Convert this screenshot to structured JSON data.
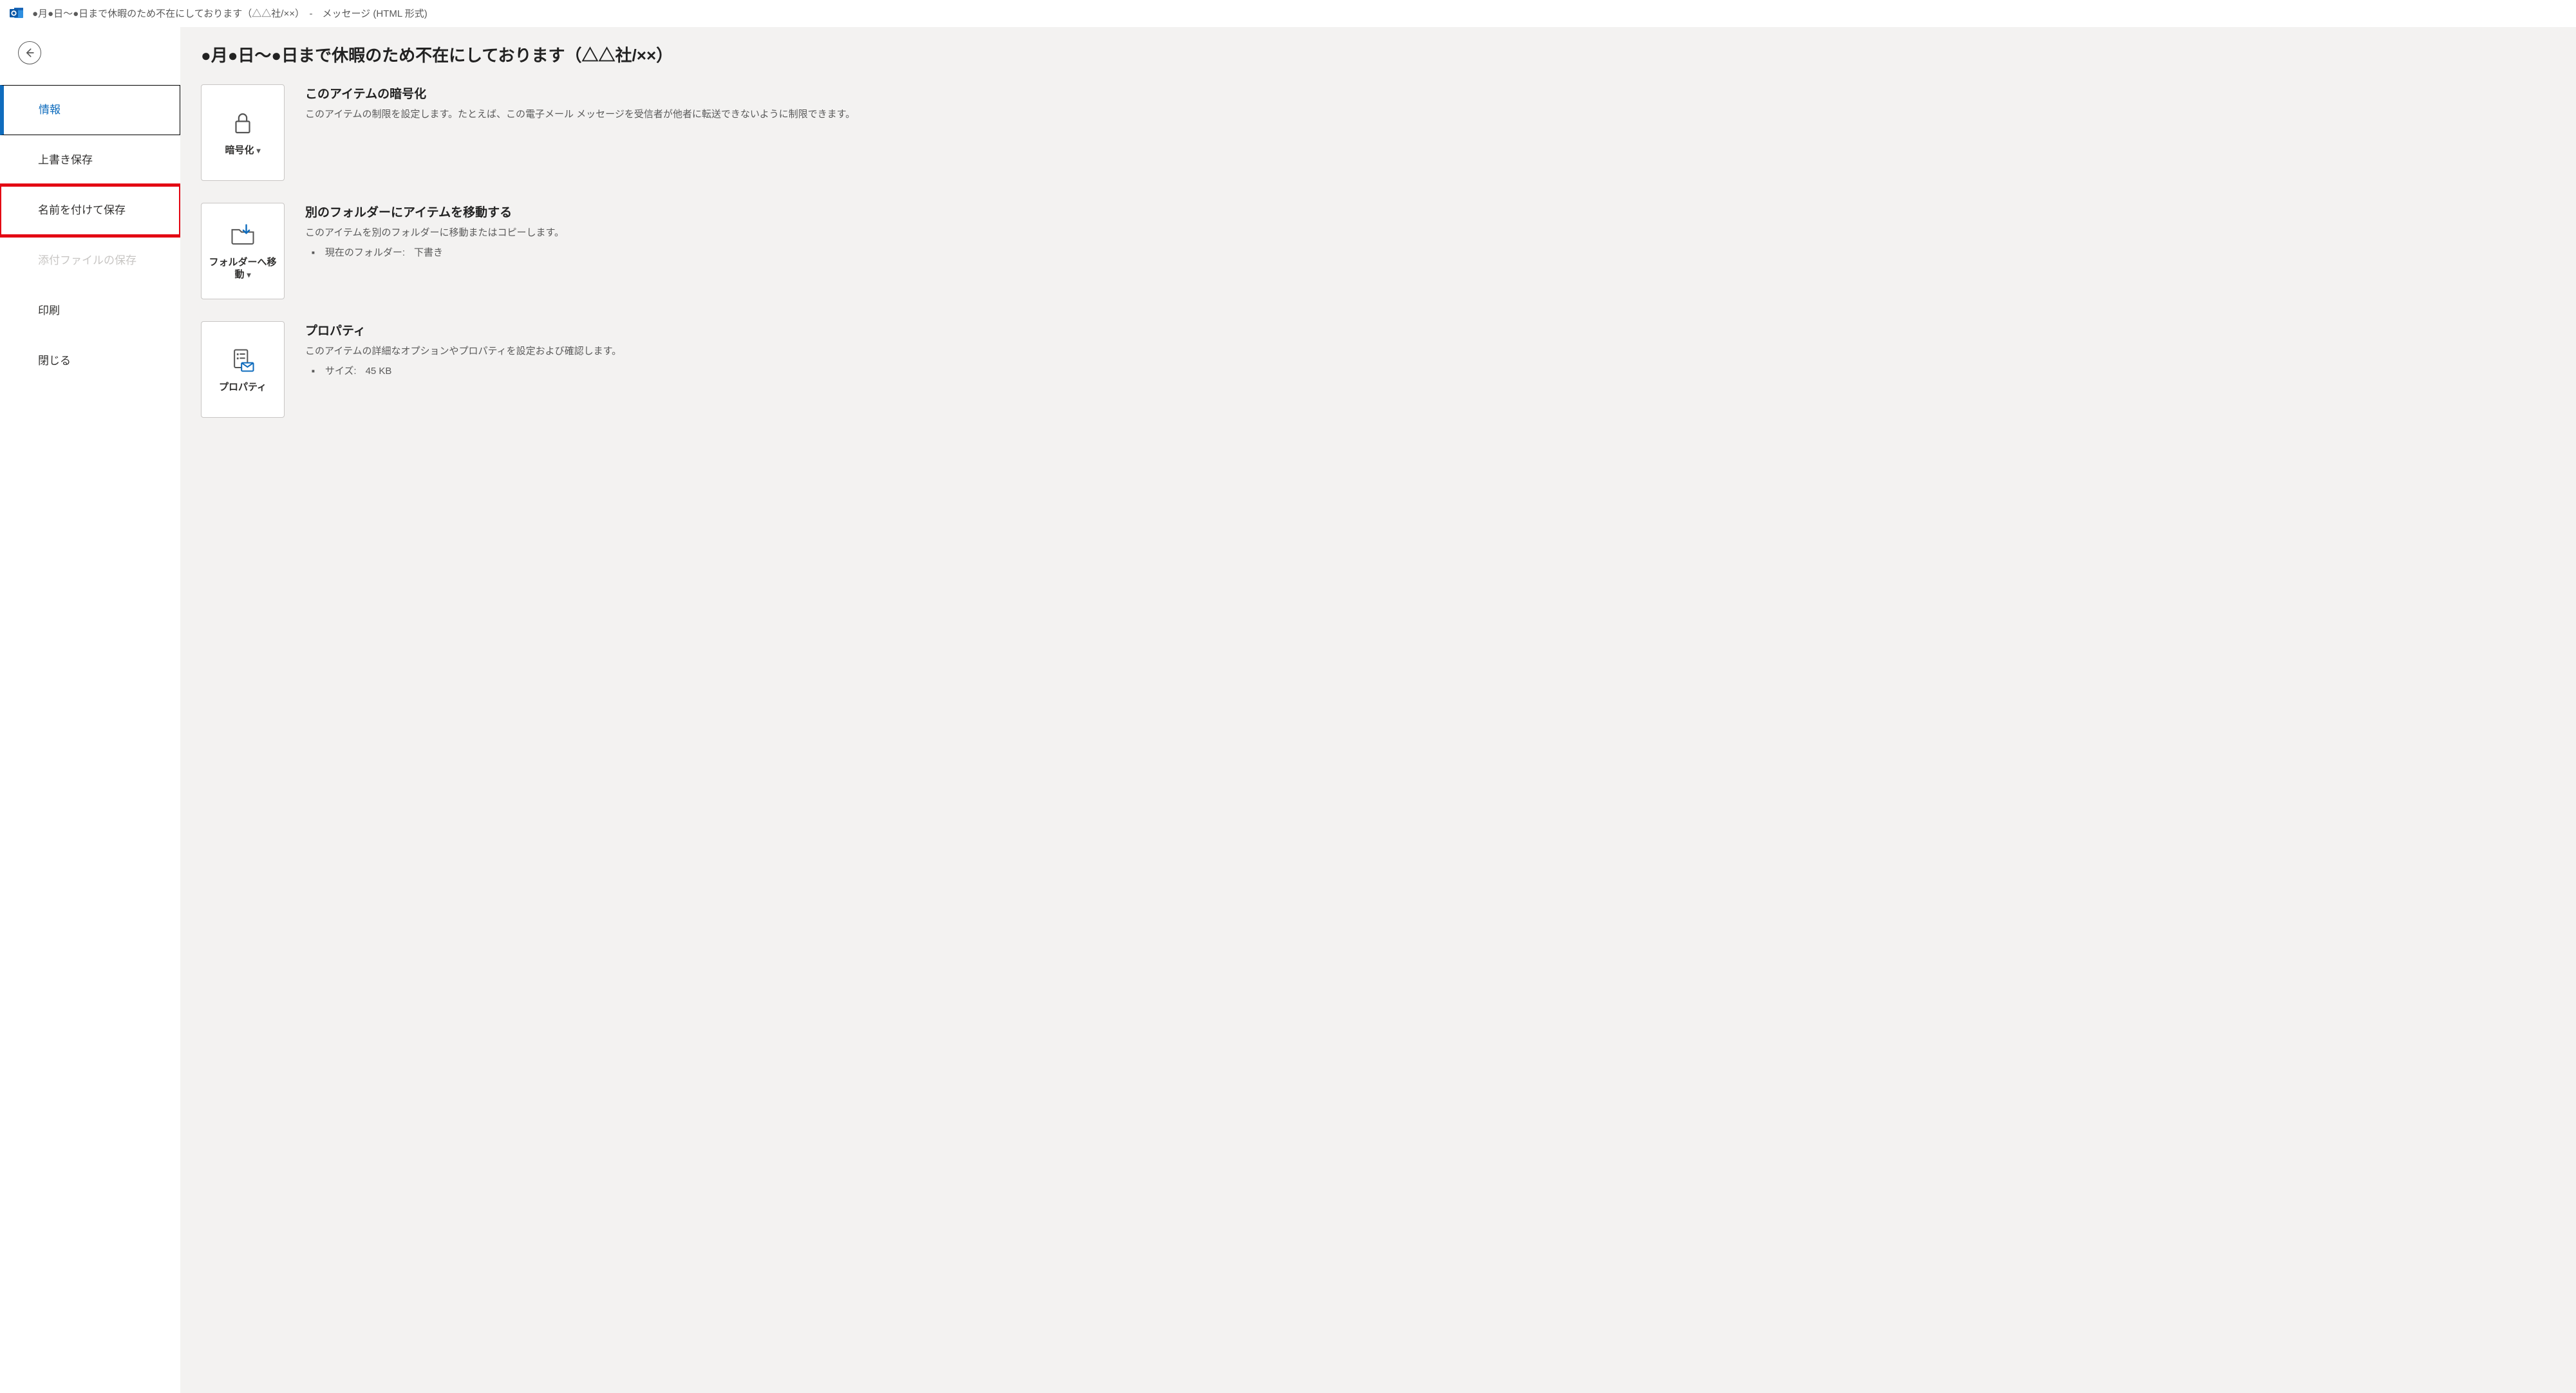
{
  "window": {
    "title": "●月●日～●日まで休暇のため不在にしております（△△社/××）　-　メッセージ (HTML 形式)"
  },
  "sidebar": {
    "items": [
      {
        "label": "情報"
      },
      {
        "label": "上書き保存"
      },
      {
        "label": "名前を付けて保存"
      },
      {
        "label": "添付ファイルの保存"
      },
      {
        "label": "印刷"
      },
      {
        "label": "閉じる"
      }
    ]
  },
  "main": {
    "heading": "●月●日～●日まで休暇のため不在にしております（△△社/××）",
    "sections": {
      "encrypt": {
        "tile_label": "暗号化",
        "title": "このアイテムの暗号化",
        "desc": "このアイテムの制限を設定します。たとえば、この電子メール メッセージを受信者が他者に転送できないように制限できます。"
      },
      "move": {
        "tile_label": "フォルダーへ移動",
        "title": "別のフォルダーにアイテムを移動する",
        "desc": "このアイテムを別のフォルダーに移動またはコピーします。",
        "rows": [
          {
            "k": "現在のフォルダー:",
            "v": "下書き"
          }
        ]
      },
      "props": {
        "tile_label": "プロパティ",
        "title": "プロパティ",
        "desc": "このアイテムの詳細なオプションやプロパティを設定および確認します。",
        "rows": [
          {
            "k": "サイズ:",
            "v": "45 KB"
          }
        ]
      }
    }
  }
}
